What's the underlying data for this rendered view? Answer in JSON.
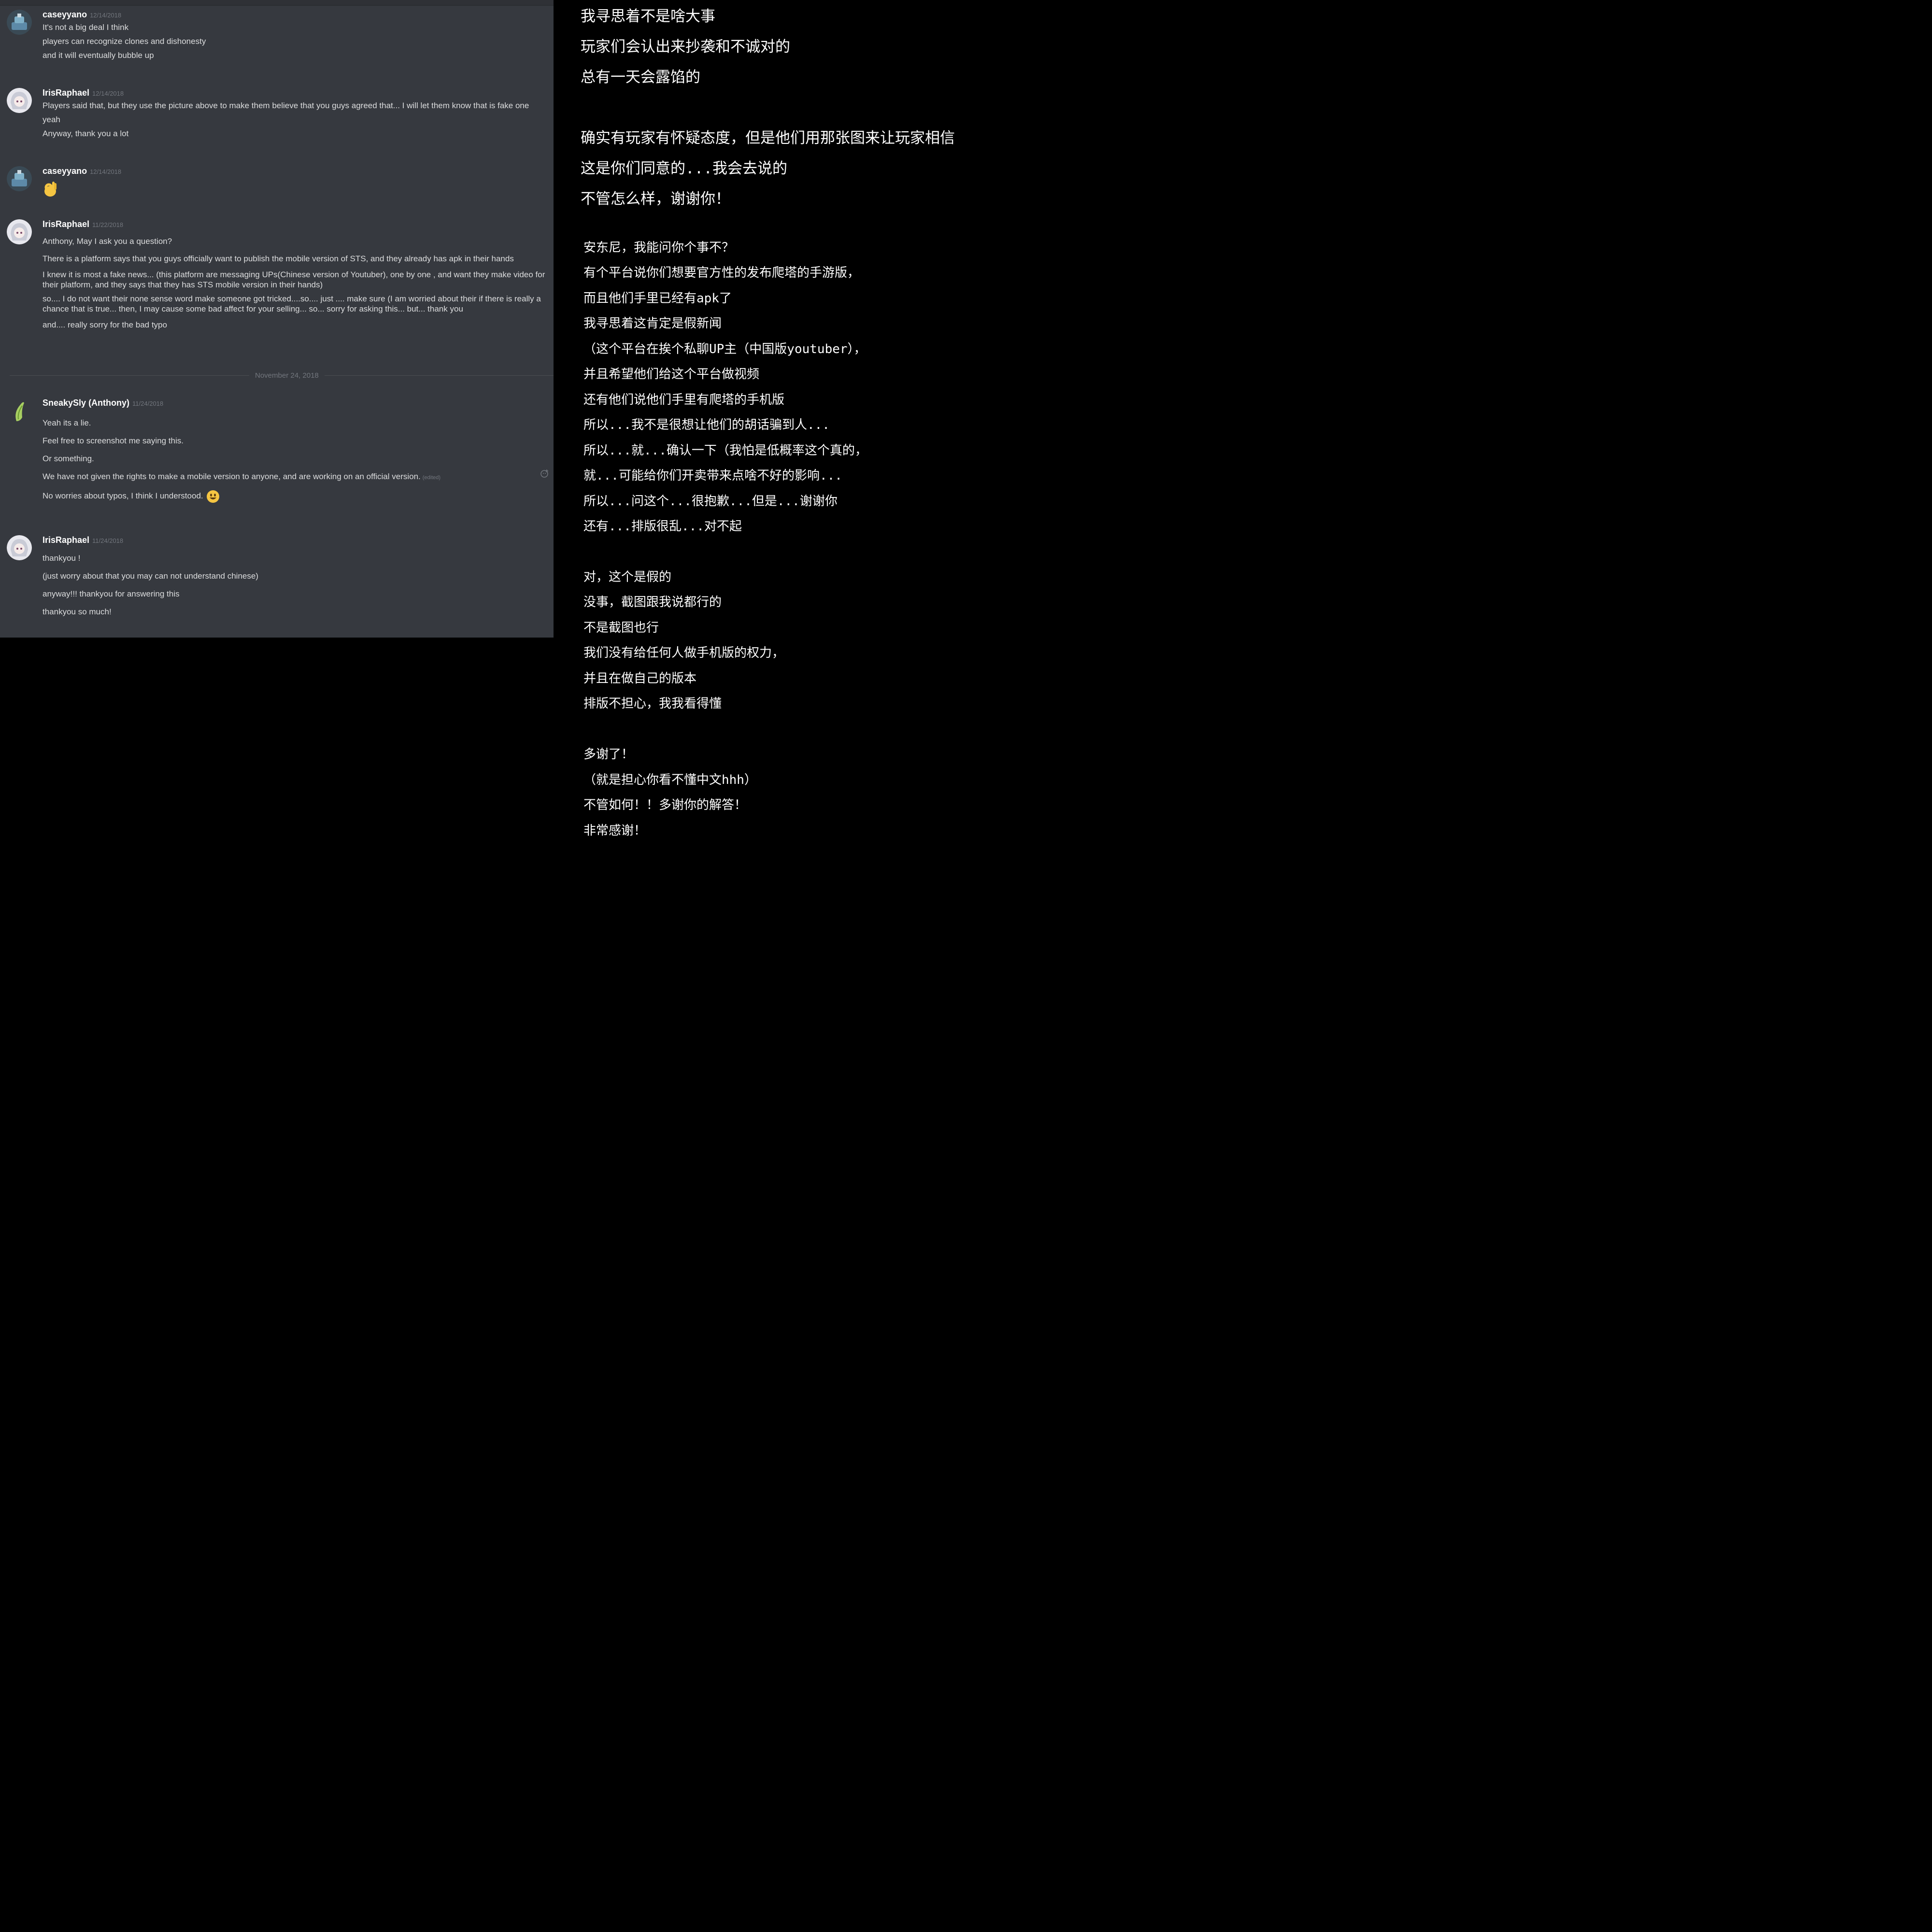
{
  "chat": {
    "date_divider": "November 24, 2018",
    "messages": [
      {
        "user": "caseyyano",
        "timestamp": "12/14/2018",
        "lines": [
          "It's not a big deal I think",
          "players can recognize clones and dishonesty",
          "and it will eventually bubble up"
        ]
      },
      {
        "user": "IrisRaphael",
        "timestamp": "12/14/2018",
        "lines": [
          "Players said that, but they use the picture above to make them believe that you guys agreed that... I will let them know that is fake one",
          "yeah",
          "Anyway, thank you a lot"
        ]
      },
      {
        "user": "caseyyano",
        "timestamp": "12/14/2018",
        "emoji": "ok-hand-emoji"
      },
      {
        "user": "IrisRaphael",
        "timestamp": "11/22/2018",
        "lines": [
          "Anthony, May I ask you a question?",
          "There is a platform says that you guys officially want to publish the mobile version of STS, and they already has apk in their hands",
          "I knew it is most a fake news... (this platform are messaging UPs(Chinese version of Youtuber), one by one , and want they make video for their platform, and they says that they has STS mobile version in their hands)",
          "so.... I do not want their none sense word make someone got tricked....so.... just .... make sure (I am worried about their if there is really a chance that is true... then, I may cause some bad affect  for your selling... so... sorry for asking this... but... thank you",
          "and.... really sorry for the bad typo"
        ]
      },
      {
        "user": "SneakySly (Anthony)",
        "timestamp": "11/24/2018",
        "lines": [
          "Yeah its a lie.",
          "Feel free to screenshot me saying this.",
          "Or something.",
          "We have not given the rights to make a mobile version to anyone, and are working on an official version.",
          "No worries about typos, I think I understood."
        ],
        "edited_label": "(edited)"
      },
      {
        "user": "IrisRaphael",
        "timestamp": "11/24/2018",
        "lines": [
          "thankyou !",
          "(just worry about that you may can not understand chinese)",
          "anyway!!! thankyou for answering this",
          "thankyou so much!"
        ]
      }
    ]
  },
  "translation": {
    "group1": [
      "我寻思着不是啥大事",
      "玩家们会认出来抄袭和不诚对的",
      "总有一天会露馅的"
    ],
    "group2": [
      "确实有玩家有怀疑态度，但是他们用那张图来让玩家相信",
      "这是你们同意的...我会去说的",
      "不管怎么样，谢谢你！"
    ],
    "group3": [
      "安东尼，我能问你个事不？",
      "有个平台说你们想要官方性的发布爬塔的手游版，",
      "而且他们手里已经有apk了",
      "我寻思着这肯定是假新闻",
      "（这个平台在挨个私聊UP主（中国版youtuber），",
      "并且希望他们给这个平台做视频",
      "还有他们说他们手里有爬塔的手机版",
      "所以...我不是很想让他们的胡话骗到人...",
      "所以...就...确认一下（我怕是低概率这个真的，",
      "就...可能给你们开卖带来点啥不好的影响...",
      "所以...问这个...很抱歉...但是...谢谢你",
      "还有...排版很乱...对不起"
    ],
    "group4": [
      "对，这个是假的",
      "没事，截图跟我说都行的",
      "不是截图也行",
      "我们没有给任何人做手机版的权力，",
      "并且在做自己的版本",
      "排版不担心，我我看得懂"
    ],
    "group5": [
      "多谢了！",
      "（就是担心你看不懂中文hhh）",
      "不管如何！！多谢你的解答！",
      "非常感谢！"
    ]
  }
}
